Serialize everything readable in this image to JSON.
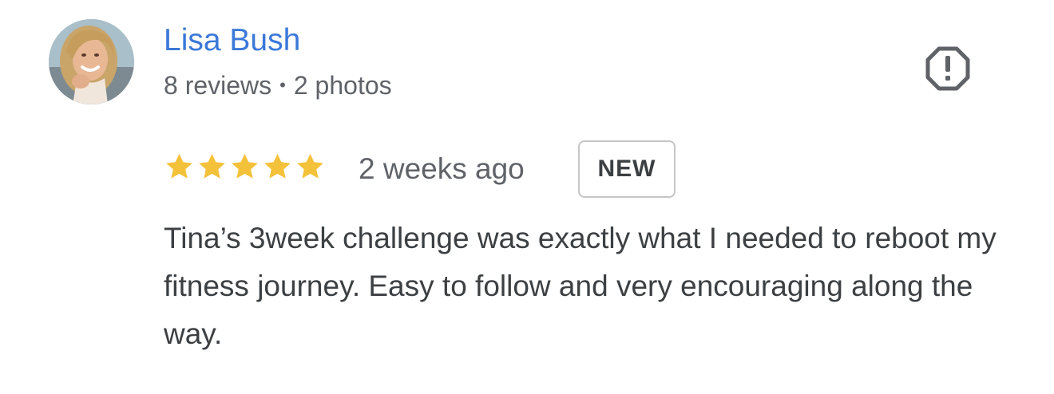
{
  "reviewer": {
    "name": "Lisa Bush",
    "reviews": "8 reviews",
    "separator": "•",
    "photos": "2 photos",
    "avatar_icon": "user-photo"
  },
  "actions": {
    "report_icon": "report-octagon-exclamation-icon"
  },
  "review": {
    "rating": 5,
    "rating_max": 5,
    "star_color": "#f4c13a",
    "time": "2 weeks ago",
    "badge": "NEW",
    "text": "Tina’s 3week challenge was exactly what I needed to reboot my fitness journey. Easy to follow and very encouraging along the way."
  },
  "colors": {
    "name": "#3b78d8",
    "meta": "#5f6368",
    "body_text": "#3c4043",
    "badge_border": "#c4c7c5"
  }
}
